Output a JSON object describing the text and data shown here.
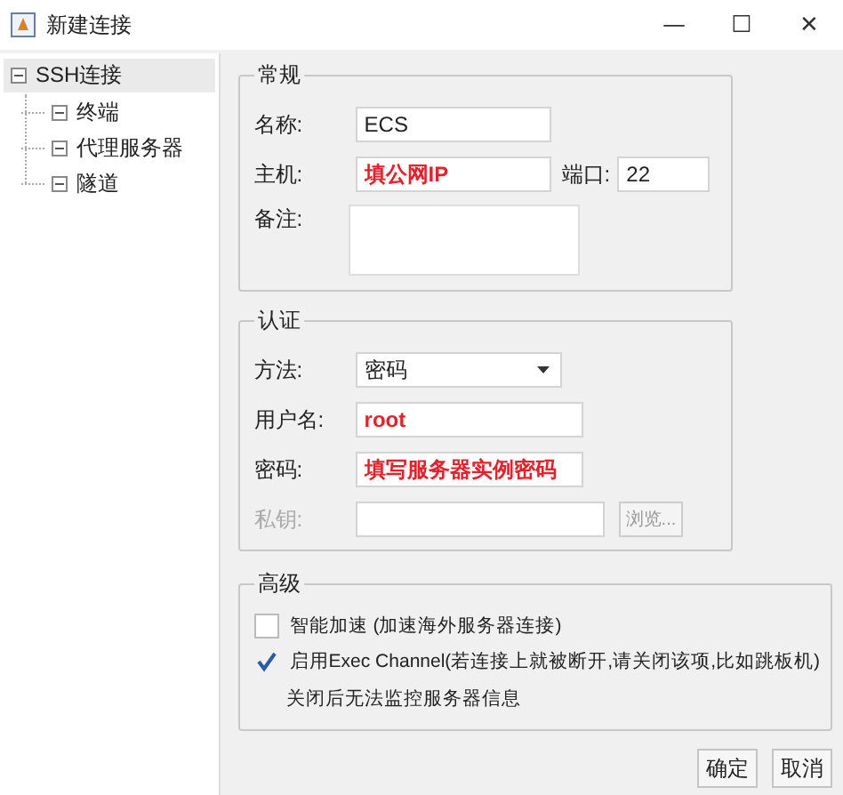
{
  "window": {
    "title": "新建连接",
    "controls": [
      "—",
      "☐",
      "✕"
    ]
  },
  "tree": {
    "root": {
      "label": "SSH连接",
      "expanded": true,
      "selected": true,
      "children": [
        {
          "label": "终端",
          "expanded": true
        },
        {
          "label": "代理服务器",
          "expanded": true
        },
        {
          "label": "隧道",
          "expanded": true
        }
      ]
    }
  },
  "general": {
    "title": "常规",
    "name": {
      "label": "名称:",
      "value": "ECS"
    },
    "host": {
      "label": "主机:",
      "value": "填公网IP",
      "kind": "annotation"
    },
    "port": {
      "label": "端口:",
      "value": "22"
    },
    "note": {
      "label": "备注:"
    }
  },
  "auth": {
    "title": "认证",
    "method": {
      "label": "方法:",
      "value": "密码"
    },
    "fields": [
      {
        "label": "用户名:",
        "value": "root",
        "kind": "annotation",
        "disabled": false
      },
      {
        "label": "密码:",
        "value": "填写服务器实例密码",
        "kind": "annotation",
        "disabled": false
      },
      {
        "label": "私钥:",
        "disabled": true,
        "button": "浏览..."
      }
    ]
  },
  "advanced": {
    "title": "高级",
    "options": [
      {
        "label": "智能加速 (加速海外服务器连接)",
        "checked": false
      },
      {
        "label": "启用Exec Channel(若连接上就被断开,请关闭该项,比如跳板机)",
        "checked": true,
        "note": "关闭后无法监控服务器信息"
      }
    ]
  },
  "buttons": [
    "确定",
    "取消"
  ]
}
